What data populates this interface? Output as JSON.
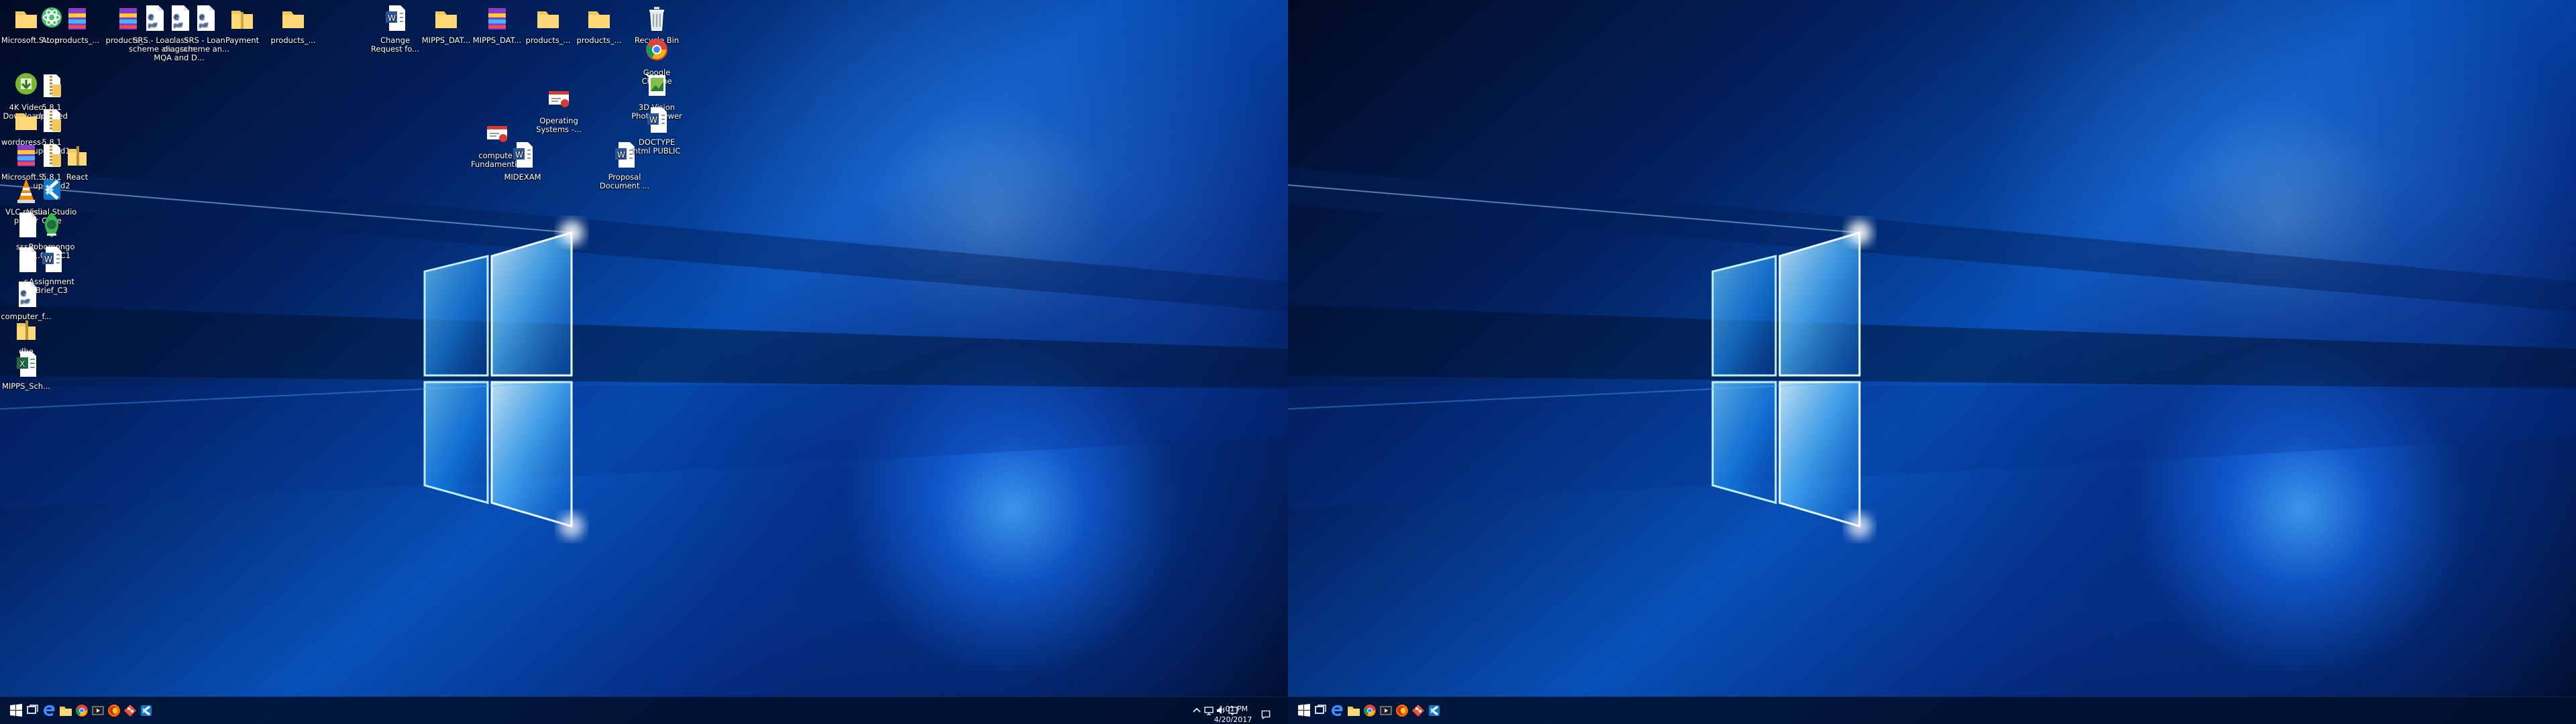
{
  "screens": {
    "left": {
      "desktop_icons": {
        "microsoft_s_1": {
          "label": "Microsoft.S...",
          "icon": "folder-icon"
        },
        "atom": {
          "label": "Atom",
          "icon": "atom-icon"
        },
        "products_archive_1": {
          "label": "products_...",
          "icon": "archive-icon"
        },
        "products_archive_2": {
          "label": "products_...",
          "icon": "archive-icon"
        },
        "srs_loan_1": {
          "label": "SRS - Loan scheme an...",
          "icon": "pdf-icon"
        },
        "class_diagram": {
          "label": "class diagram MQA and D...",
          "icon": "pdf-icon"
        },
        "srs_loan_2": {
          "label": "SRS - Loan scheme an...",
          "icon": "pdf-icon"
        },
        "payment": {
          "label": "Payment",
          "icon": "folder-icon"
        },
        "products_folder_1": {
          "label": "products_...",
          "icon": "folder-icon"
        },
        "change_request": {
          "label": "Change Request fo...",
          "icon": "word-document-icon"
        },
        "mipps_dat_1": {
          "label": "MIPPS_DAT...",
          "icon": "folder-icon"
        },
        "mipps_dat_2": {
          "label": "MIPPS_DAT...",
          "icon": "archive-icon"
        },
        "products_folder_2": {
          "label": "products_...",
          "icon": "folder-icon"
        },
        "products_folder_3": {
          "label": "products_...",
          "icon": "folder-icon"
        },
        "video_downloader": {
          "label": "4K Video Downloader",
          "icon": "green-app-icon"
        },
        "updated_5_8_1": {
          "label": "5.8.1 updated",
          "icon": "zip-folder-icon"
        },
        "operating_systems": {
          "label": "Operating Systems -...",
          "icon": "presentation-icon"
        },
        "wordpress": {
          "label": "wordpress-...",
          "icon": "folder-icon"
        },
        "updated1": {
          "label": "5.8.1 updated1",
          "icon": "zip-folder-icon"
        },
        "computer_fundamentals": {
          "label": "computer Fundamenti...",
          "icon": "presentation-icon"
        },
        "microsoft_s_2": {
          "label": "Microsoft.S...",
          "icon": "archive-icon"
        },
        "updated2": {
          "label": "5.8.1 updated2",
          "icon": "zip-folder-icon"
        },
        "react": {
          "label": "React",
          "icon": "zip-folder-icon"
        },
        "midexam": {
          "label": "MIDEXAM",
          "icon": "word-document-icon"
        },
        "proposal_document": {
          "label": "Proposal Document ...",
          "icon": "word-document-icon"
        },
        "vlc": {
          "label": "VLC media player",
          "icon": "vlc-icon"
        },
        "vs_code": {
          "label": "Visual Studio Code",
          "icon": "visual-studio-code-icon"
        },
        "sssss": {
          "label": "sssss",
          "icon": "blank-file-icon"
        },
        "robomongo": {
          "label": "Robomongo 1.0.0-RC1",
          "icon": "robomongo-icon"
        },
        "s": {
          "label": "s",
          "icon": "blank-file-icon"
        },
        "assignment": {
          "label": "Assignment Brief_C3",
          "icon": "word-document-icon"
        },
        "computer_f": {
          "label": "computer_f...",
          "icon": "pdf-icon"
        },
        "dhe": {
          "label": "dhe",
          "icon": "zip-folder-icon"
        },
        "mipps_sch": {
          "label": "MIPPS_Sch...",
          "icon": "excel-icon"
        },
        "recycle_bin": {
          "label": "Recycle Bin",
          "icon": "recycle-bin-icon"
        },
        "google_chrome": {
          "label": "Google Chrome",
          "icon": "chrome-icon"
        },
        "photo_viewer": {
          "label": "3D Vision Photo Viewer",
          "icon": "photo-viewer-icon"
        },
        "doctype": {
          "label": "DOCTYPE html PUBLIC",
          "icon": "word-document-icon"
        }
      },
      "taskbar": {
        "clock_time": "4:01 PM",
        "clock_date": "4/20/2017",
        "buttons": [
          "windows-start",
          "task-view",
          "edge",
          "file-explorer",
          "chrome",
          "video-player",
          "firefox",
          "git",
          "visual-studio-code"
        ]
      }
    },
    "right": {
      "taskbar": {
        "buttons": [
          "windows-start",
          "task-view",
          "edge",
          "file-explorer",
          "chrome",
          "video-player",
          "firefox",
          "git",
          "visual-studio-code"
        ]
      }
    }
  },
  "colors": {
    "desktop_blue": "#0750b8",
    "taskbar": "#00102c",
    "accent": "#0a68d8",
    "folder": "#f2c75d",
    "pdf": "#0b62c8",
    "word": "#2b579a",
    "excel": "#1d6f42",
    "vlc": "#f48a00",
    "atom": "#46c06d"
  }
}
